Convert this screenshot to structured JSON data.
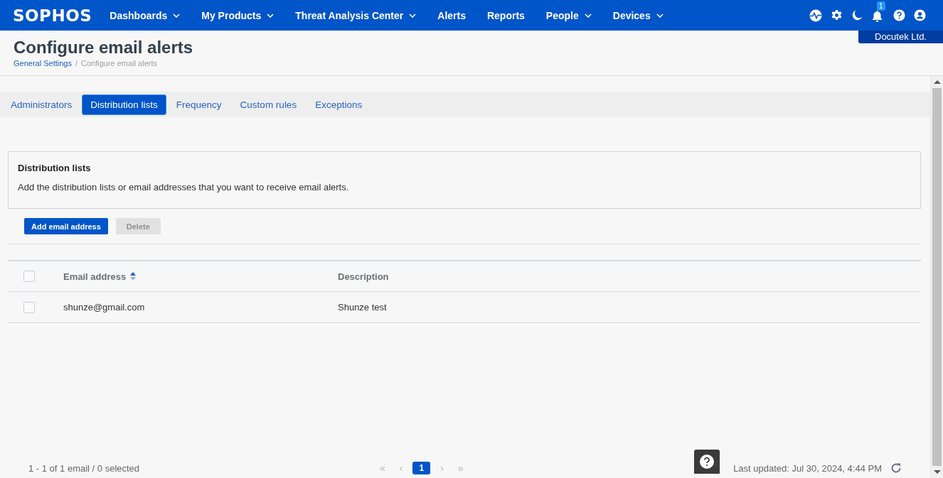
{
  "nav": {
    "logo": "SOPHOS",
    "items": [
      {
        "label": "Dashboards",
        "has_menu": true
      },
      {
        "label": "My Products",
        "has_menu": true
      },
      {
        "label": "Threat Analysis Center",
        "has_menu": true
      },
      {
        "label": "Alerts",
        "has_menu": false
      },
      {
        "label": "Reports",
        "has_menu": false
      },
      {
        "label": "People",
        "has_menu": true
      },
      {
        "label": "Devices",
        "has_menu": true
      }
    ],
    "notification_count": "1",
    "tenant": "Docutek Ltd."
  },
  "page": {
    "title": "Configure email alerts",
    "breadcrumb": [
      {
        "label": "General Settings",
        "kind": "link"
      },
      {
        "label": "/",
        "kind": "separator"
      },
      {
        "label": "Configure email alerts",
        "kind": "current"
      }
    ]
  },
  "tabs": [
    {
      "label": "Administrators",
      "selected": false
    },
    {
      "label": "Distribution lists",
      "selected": true
    },
    {
      "label": "Frequency",
      "selected": false
    },
    {
      "label": "Custom rules",
      "selected": false
    },
    {
      "label": "Exceptions",
      "selected": false
    }
  ],
  "panel": {
    "title": "Distribution lists",
    "description": "Add the distribution lists or email addresses that you want to receive email alerts."
  },
  "buttons": [
    {
      "label": "Add email address",
      "disabled": false
    },
    {
      "label": "Delete",
      "disabled": true
    }
  ],
  "table": {
    "header_checked": false,
    "columns": [
      {
        "label": "Email address",
        "sorted_ascending": true
      },
      {
        "label": "Description",
        "sorted_ascending": false
      }
    ],
    "rows": [
      {
        "checked": false,
        "cells": [
          "shunze@gmail.com",
          "Shunze test"
        ]
      }
    ]
  },
  "footer": {
    "summary": "1 - 1 of 1 email / 0 selected",
    "pages": [
      {
        "label": "«",
        "kind": "nav"
      },
      {
        "label": "‹",
        "kind": "nav"
      },
      {
        "label": "1",
        "kind": "page",
        "selected": true
      },
      {
        "label": "›",
        "kind": "nav"
      },
      {
        "label": "»",
        "kind": "nav"
      }
    ],
    "last_updated": "Last updated: Jul 30, 2024, 4:44 PM"
  }
}
